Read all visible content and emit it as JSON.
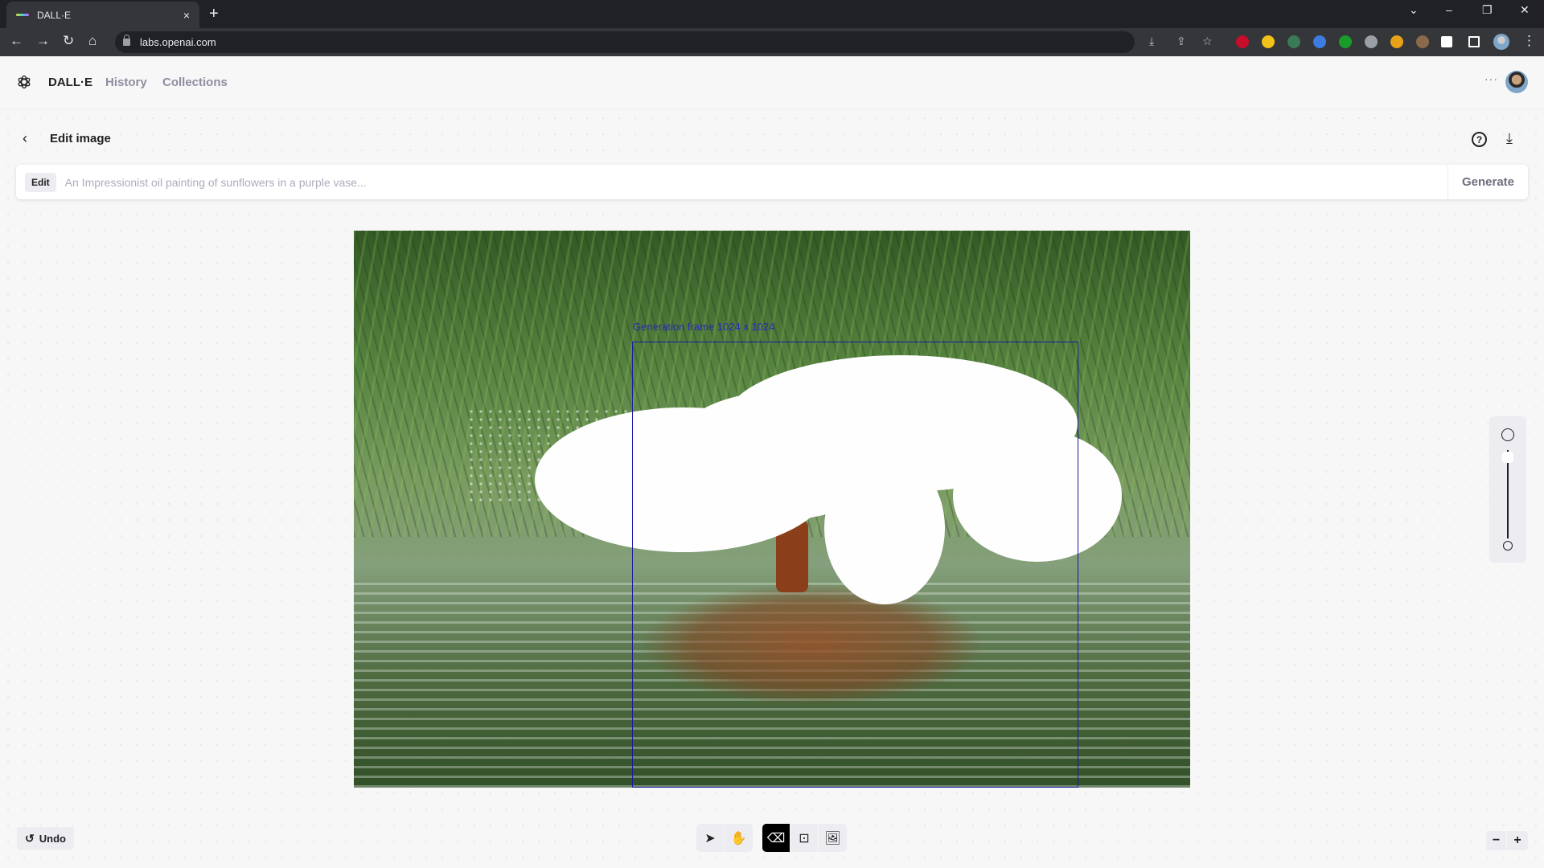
{
  "browser": {
    "tab_title": "DALL·E",
    "tab_close": "×",
    "new_tab": "+",
    "url": "labs.openai.com",
    "nav": {
      "back": "←",
      "forward": "→",
      "reload": "↻",
      "home": "⌂"
    },
    "window_controls": {
      "tab_search": "⌄",
      "minimize": "–",
      "restore": "❐",
      "close": "✕"
    },
    "omnibox_icons": {
      "install": "⤓",
      "share": "⇪",
      "bookmark": "☆"
    },
    "extensions": [
      {
        "name": "adblock-plus",
        "color": "#c70d2c"
      },
      {
        "name": "sticky-notes",
        "color": "#f0c21a"
      },
      {
        "name": "rainbow-ext",
        "color": "#3b7a57"
      },
      {
        "name": "tag-ext",
        "color": "#3d7be0"
      },
      {
        "name": "download-ext",
        "color": "#1a9c2a"
      },
      {
        "name": "camera-ext",
        "color": "#9aa0a6"
      },
      {
        "name": "globe-ext",
        "color": "#e8a21a"
      },
      {
        "name": "cookie-ext",
        "color": "#8a6a4a"
      }
    ],
    "menu": "⋮"
  },
  "header": {
    "brand": "DALL·E",
    "nav_links": [
      "History",
      "Collections"
    ],
    "more_label": "···"
  },
  "editor": {
    "back_icon": "‹",
    "title": "Edit image",
    "help_icon": "?",
    "download_icon": "⤓",
    "prompt": {
      "chip": "Edit",
      "placeholder": "An Impressionist oil painting of sunflowers in a purple vase...",
      "value": "",
      "generate_label": "Generate"
    },
    "generation_frame_label": "Generation frame 1024 x 1024",
    "brush_size": {
      "value_fraction": 0.95
    },
    "colors": {
      "frame": "#1a1aa0",
      "active_tool": "#000000",
      "mask": "#fefefe"
    }
  },
  "bottom": {
    "undo_label": "Undo",
    "undo_icon": "↺",
    "tools": [
      {
        "name": "select",
        "icon": "➤",
        "active": false
      },
      {
        "name": "pan",
        "icon": "✋",
        "active": false
      }
    ],
    "tools2": [
      {
        "name": "eraser",
        "icon": "⌫",
        "active": true
      },
      {
        "name": "add-frame",
        "icon": "⊡",
        "active": false
      },
      {
        "name": "upload-image",
        "icon": "🖼",
        "active": false
      }
    ],
    "zoom_out": "−",
    "zoom_in": "+"
  }
}
